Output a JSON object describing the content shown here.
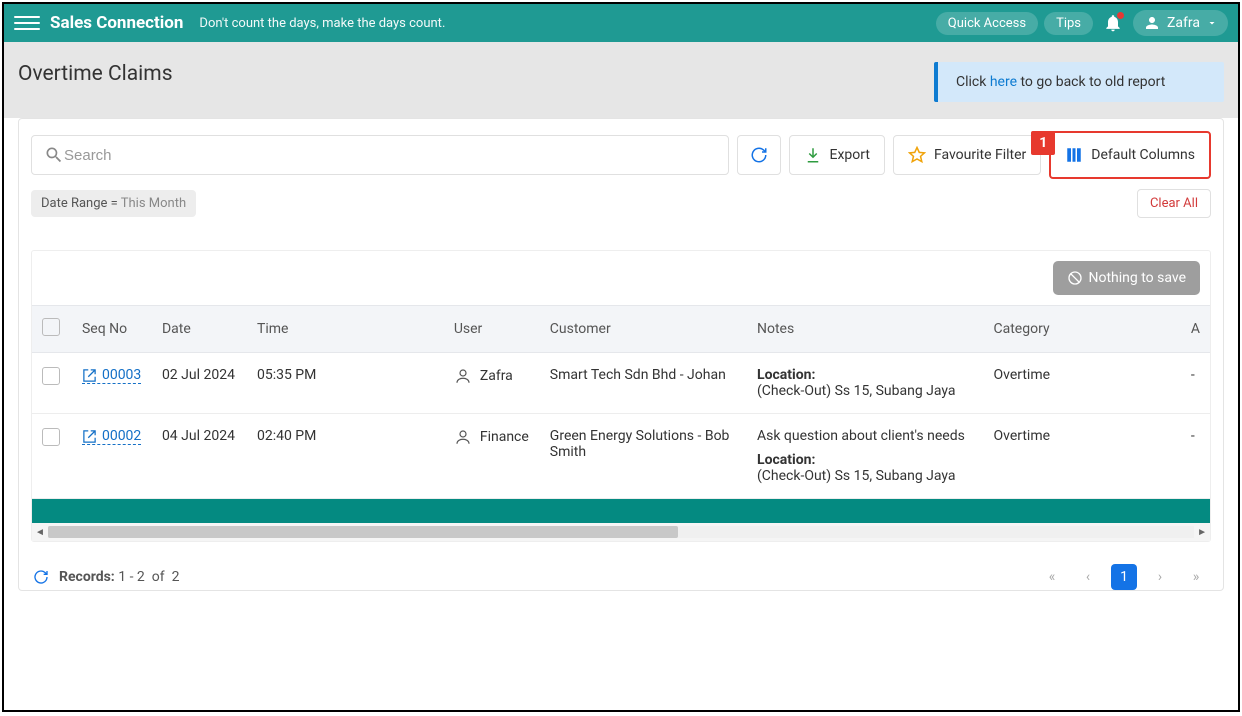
{
  "topbar": {
    "brand": "Sales Connection",
    "tagline": "Don't count the days, make the days count.",
    "quick_access": "Quick Access",
    "tips": "Tips",
    "user": "Zafra"
  },
  "page": {
    "title": "Overtime Claims",
    "notice_prefix": "Click ",
    "notice_link": "here",
    "notice_suffix": " to go back to old report"
  },
  "toolbar": {
    "search_placeholder": "Search",
    "export": "Export",
    "favourite": "Favourite Filter",
    "default_cols": "Default Columns",
    "callout": "1"
  },
  "filters": {
    "chip_label": "Date Range = ",
    "chip_value": "This Month",
    "clear_all": "Clear All"
  },
  "data_controls": {
    "nothing_to_save": "Nothing to save"
  },
  "columns": {
    "seq_no": "Seq No",
    "date": "Date",
    "time": "Time",
    "user": "User",
    "customer": "Customer",
    "notes": "Notes",
    "category": "Category",
    "last": "A"
  },
  "rows": [
    {
      "seq": "00003",
      "date": "02 Jul 2024",
      "time": "05:35 PM",
      "user": "Zafra",
      "customer": "Smart Tech Sdn Bhd - Johan",
      "note_extra": "",
      "loc_label": "Location:",
      "loc_value": "(Check-Out) Ss 15, Subang Jaya",
      "category": "Overtime",
      "last": "-"
    },
    {
      "seq": "00002",
      "date": "04 Jul 2024",
      "time": "02:40 PM",
      "user": "Finance",
      "customer": "Green Energy Solutions - Bob Smith",
      "note_extra": "Ask question about client's needs",
      "loc_label": "Location:",
      "loc_value": "(Check-Out) Ss 15, Subang Jaya",
      "category": "Overtime",
      "last": "-"
    }
  ],
  "footer": {
    "records_label": "Records:",
    "records_range": "1 - 2",
    "of": "of",
    "records_total": "2",
    "page_current": "1"
  }
}
